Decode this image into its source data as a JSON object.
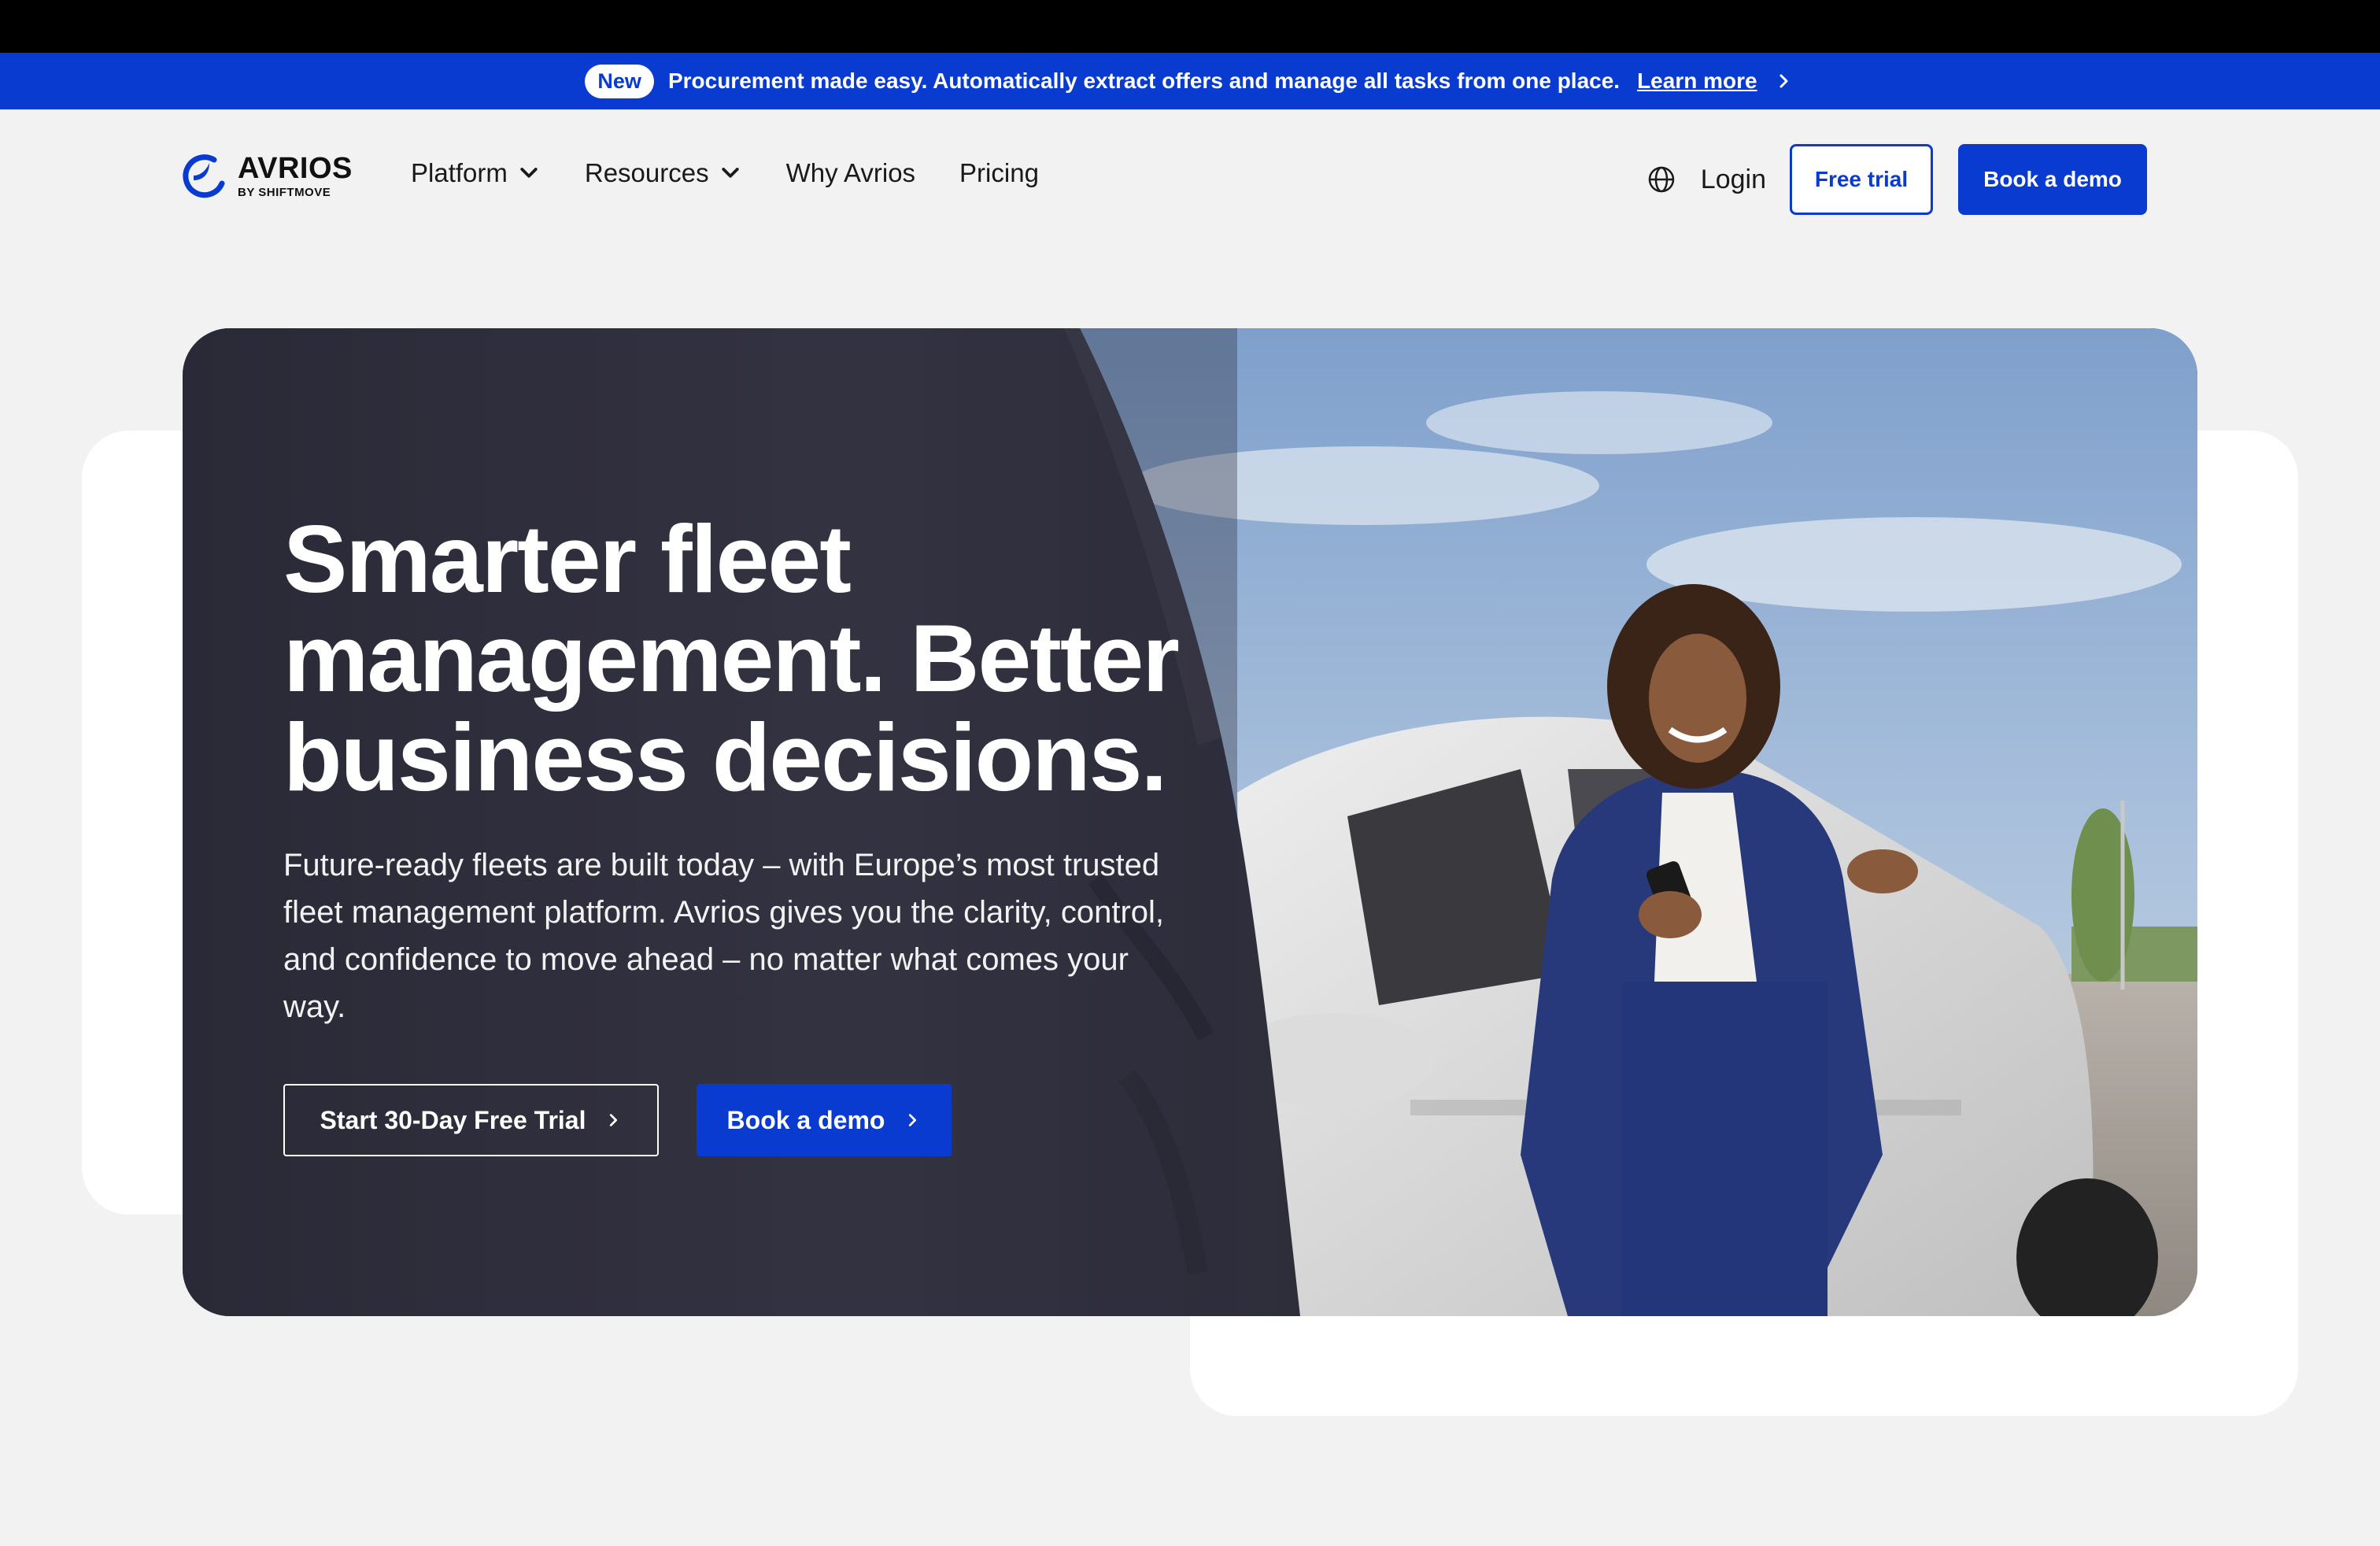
{
  "announcement": {
    "badge": "New",
    "text": "Procurement made easy. Automatically extract offers and manage all tasks from one place.",
    "link": "Learn more"
  },
  "brand": {
    "name": "AVRIOS",
    "sub": "BY SHIFTMOVE",
    "color": "#0a3bd1"
  },
  "nav": {
    "items": [
      {
        "label": "Platform",
        "dropdown": true
      },
      {
        "label": "Resources",
        "dropdown": true
      },
      {
        "label": "Why Avrios",
        "dropdown": false
      },
      {
        "label": "Pricing",
        "dropdown": false
      }
    ],
    "login": "Login",
    "free_trial": "Free trial",
    "book_demo": "Book a demo"
  },
  "hero": {
    "headline_lines": [
      "Smarter fleet",
      "management. Better",
      "business decisions."
    ],
    "subtext": "Future-ready fleets are built today – with Europe’s most trusted fleet management platform. Avrios gives you the clarity, control, and confidence to move ahead – no matter what comes your way.",
    "cta_primary": "Start 30-Day Free Trial",
    "cta_secondary": "Book a demo"
  }
}
